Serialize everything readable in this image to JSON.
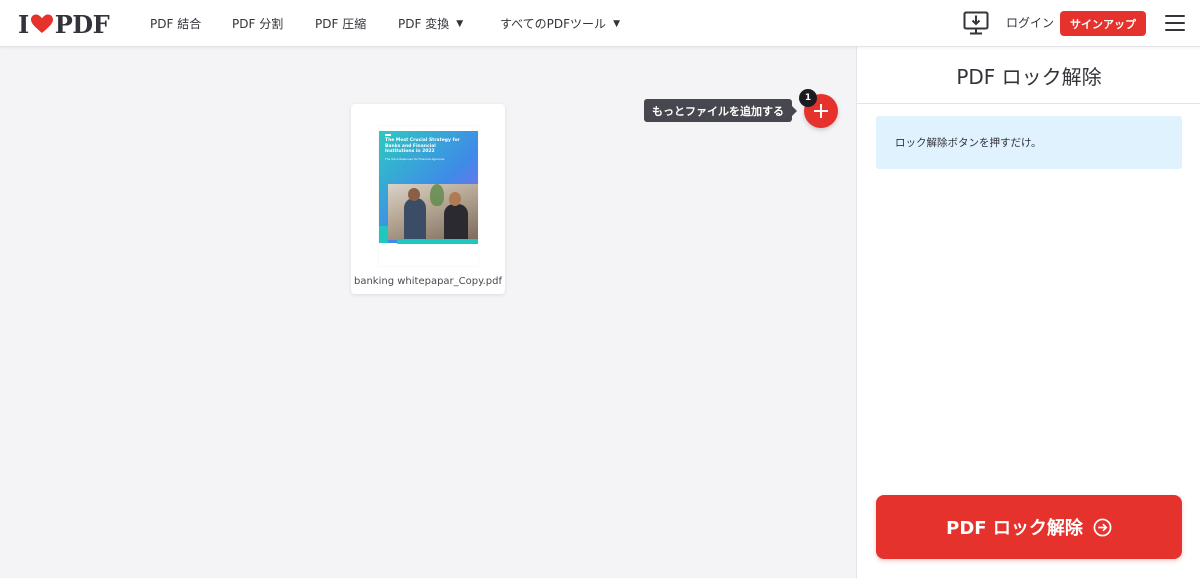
{
  "header": {
    "logo": {
      "left": "I",
      "right": "PDF"
    },
    "nav": [
      {
        "label": "PDF 結合",
        "has_caret": false
      },
      {
        "label": "PDF 分割",
        "has_caret": false
      },
      {
        "label": "PDF 圧縮",
        "has_caret": false
      },
      {
        "label": "PDF 変換",
        "has_caret": true
      },
      {
        "label": "すべてのPDFツール",
        "has_caret": true
      }
    ],
    "login_label": "ログイン",
    "signup_label": "サインアップ"
  },
  "workspace": {
    "file": {
      "name": "banking whitepapar_Copy.pdf",
      "thumb_title": "The Most Crucial Strategy for Banks and Financial Institutions in 2022",
      "thumb_subtitle": "The Voice Response for Financial Agencies"
    },
    "add_more_tooltip": "もっとファイルを追加する",
    "file_count": "1"
  },
  "sidebar": {
    "title": "PDF ロック解除",
    "info": "ロック解除ボタンを押すだけ。",
    "action_label": "PDF ロック解除"
  },
  "colors": {
    "brand_red": "#e5322d",
    "info_bg": "#dff2fd",
    "text_dark": "#33333b"
  }
}
